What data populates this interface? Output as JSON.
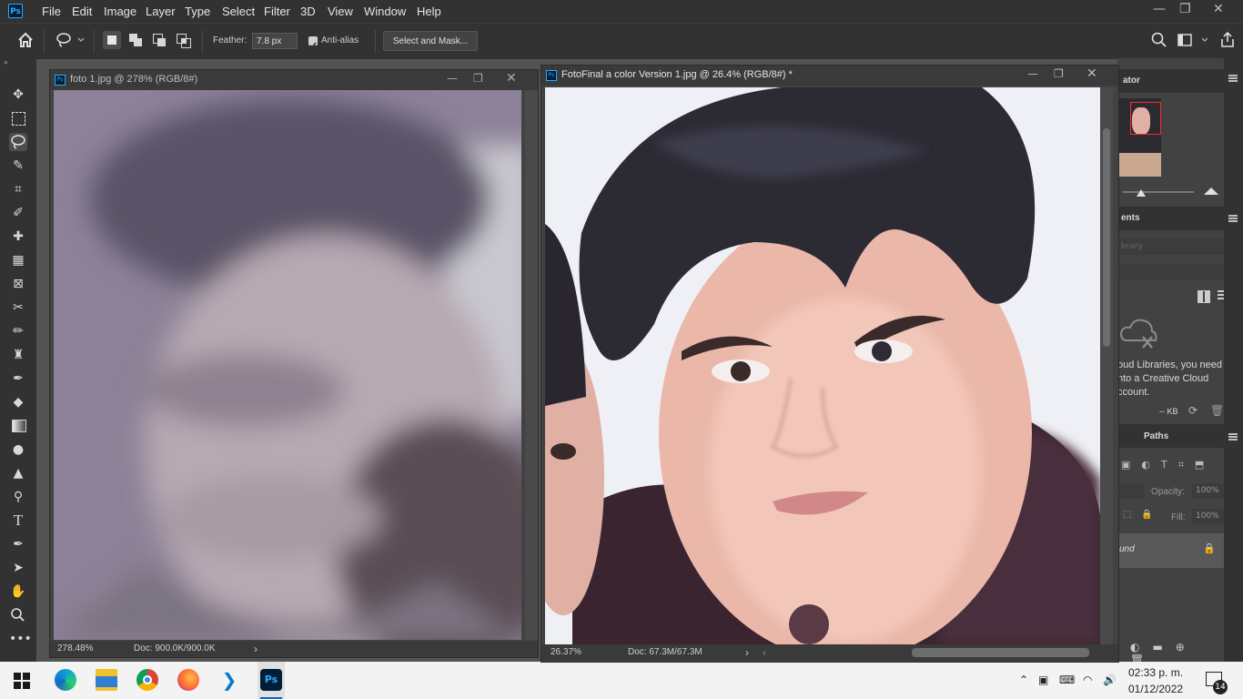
{
  "app": {
    "logo": "Ps"
  },
  "menu": [
    "File",
    "Edit",
    "Image",
    "Layer",
    "Type",
    "Select",
    "Filter",
    "3D",
    "View",
    "Window",
    "Help"
  ],
  "window_controls": {
    "minimize": "—",
    "restore": "❐",
    "close": "✕"
  },
  "options": {
    "feather_label": "Feather:",
    "feather_value": "7.8 px",
    "antialias_label": "Anti-alias",
    "select_mask_label": "Select and Mask..."
  },
  "tools": [
    "move-icon",
    "marquee-icon",
    "lasso-icon",
    "quick-select-icon",
    "crop-icon",
    "eyedropper-icon",
    "healing-icon",
    "brush-icon",
    "frame-icon",
    "history-brush-icon",
    "paint-brush-icon",
    "stamp-icon",
    "history-icon",
    "eraser-icon",
    "gradient-icon",
    "blur-icon",
    "sharpen-icon",
    "dodge-icon",
    "type-icon",
    "pen-icon",
    "path-select-icon",
    "hand-icon",
    "zoom-icon",
    "more-icon"
  ],
  "doc1": {
    "title": "foto 1.jpg @ 278% (RGB/8#)",
    "zoom": "278.48%",
    "doc_size": "Doc: 900.0K/900.0K",
    "arrow": "›"
  },
  "doc2": {
    "title": "FotoFinal a color Version 1.jpg @ 26.4% (RGB/8#) *",
    "zoom": "26.37%",
    "doc_size": "Doc: 67.3M/67.3M",
    "arrow": "›",
    "arrow_left": "‹"
  },
  "panels": {
    "navigator_tab": "ator",
    "adjustments_tab": "ents",
    "library_placeholder": "brary",
    "cc_message": [
      "oud Libraries, you need",
      "nto a Creative Cloud",
      "ccount."
    ],
    "kb": "-- KB",
    "paths_tab": "Paths",
    "opacity_label": "Opacity:",
    "opacity_value": "100%",
    "fill_label": "Fill:",
    "fill_value": "100%",
    "layer_name": "und"
  },
  "taskbar": {
    "time": "02:33 p. m.",
    "date": "01/12/2022",
    "notifications": "14",
    "apps": [
      "windows-start",
      "edge",
      "file-explorer",
      "chrome",
      "firefox",
      "vscode",
      "photoshop"
    ]
  },
  "colors": {
    "accent": "#31a8ff",
    "ui_dark": "#323232",
    "ui_mid": "#424242",
    "canvas_bg": "#535353"
  }
}
